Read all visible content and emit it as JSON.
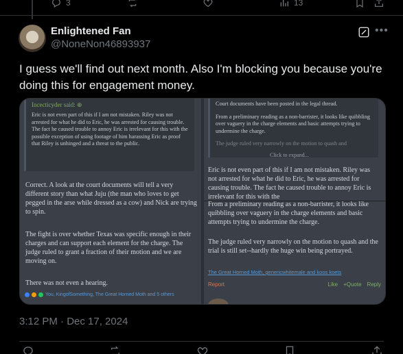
{
  "prev_post_actions": {
    "replies": "3",
    "views": "13"
  },
  "author": {
    "display_name": "Enlightened Fan",
    "handle": "@NoneNon46893937"
  },
  "tweet": {
    "text": "I guess we'll find out next month. Also I'm blocking you because you're doing this for engagement money.",
    "timestamp": "3:12 PM · Dec 17, 2024"
  },
  "media": {
    "left": {
      "quote_author": "Incecticyder said: ⊕",
      "quote_text": "Eric is not even part of this if I am not mistaken. Riley was not arrested for what he did to Eric, he was arrested for causing trouble. The fact he caused trouble to annoy Eric is irrelevant for this with the possible exception of using footage of him harassing Eric as proof that Riley is unhinged and a threat to the public.",
      "para1": "Correct. A look at the court documents will tell a very different story than what Juju (the man who loves to get pegged in the arse while dressed as a cow) and Nick are trying to spin.",
      "para2": "The fight is over whether Texas was specific enough in their charges and can support each element for the charge. The judge ruled to grant a fraction of their motion and we are moving on.",
      "para3": "There was not even a hearing.",
      "reactions": "You, KingofSomething, The Great Horned Moth and 5 others"
    },
    "right": {
      "quote_line1": "Court documents have been posted in the legal thread.",
      "quote_line2": "From a preliminary reading as a non-barrister, it looks like quibbling over vaguery in the charge elements and basic attempts trying to undermine the charge.",
      "quote_line3": "The judge ruled very narrowly on the motion to quash and",
      "expand": "Click to expand...",
      "para1": "Eric is not even part of this if I am not mistaken. Riley was not arrested for what he did to Eric, he was arrested for causing trouble. The fact he caused trouble to annoy Eric is irrelevant for this with the",
      "para2": "From a preliminary reading as a non-barrister, it looks like quibbling over vaguery in the charge elements and basic attempts trying to undermine the charge.",
      "para3": "The judge ruled very narrowly on the motion to quash and the trial is still set--hardly the huge win being portrayed.",
      "reactions": "The Great Horned Moth, genericwhitemale and koos koets",
      "report": "Report",
      "like": "Like",
      "quote": "+Quote",
      "reply": "Reply"
    }
  },
  "colors": {
    "background": "#000000",
    "text": "#e7e9ea",
    "muted": "#71767b",
    "divider": "#2f3336"
  }
}
